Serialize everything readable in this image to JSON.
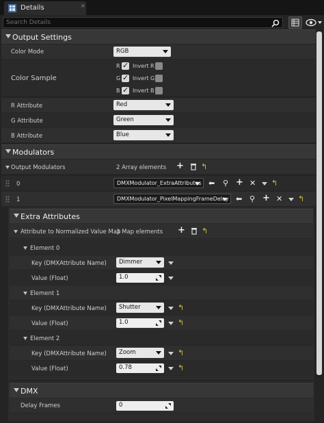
{
  "tab": {
    "title": "Details",
    "close": "×"
  },
  "search": {
    "placeholder": "Search Details"
  },
  "output_settings": {
    "title": "Output Settings",
    "color_mode": {
      "label": "Color Mode",
      "value": "RGB"
    },
    "color_sample": {
      "label": "Color Sample",
      "channels": [
        {
          "name": "R",
          "checked": true,
          "invert_label": "Invert R",
          "invert": false
        },
        {
          "name": "G",
          "checked": true,
          "invert_label": "Invert G",
          "invert": false
        },
        {
          "name": "B",
          "checked": true,
          "invert_label": "Invert B",
          "invert": false
        }
      ]
    },
    "r_attribute": {
      "label": "R Attribute",
      "value": "Red"
    },
    "g_attribute": {
      "label": "G Attribute",
      "value": "Green"
    },
    "b_attribute": {
      "label": "B Attribute",
      "value": "Blue"
    }
  },
  "modulators": {
    "title": "Modulators",
    "output_modulators": {
      "label": "Output Modulators",
      "count_text": "2 Array elements"
    },
    "elements": [
      {
        "index": "0",
        "value": "DMXModulator_ExtraAttributes"
      },
      {
        "index": "1",
        "value": "DMXModulator_PixelMappingFrameDelay"
      }
    ]
  },
  "extra_attributes": {
    "title": "Extra Attributes",
    "map_label": "Attribute to Normalized Value Map",
    "map_count": "3 Map elements",
    "key_label": "Key (DMXAttribute Name)",
    "value_label": "Value (Float)",
    "elements": [
      {
        "title": "Element 0",
        "key": "Dimmer",
        "value": "1.0"
      },
      {
        "title": "Element 1",
        "key": "Shutter",
        "value": "1.0"
      },
      {
        "title": "Element 2",
        "key": "Zoom",
        "value": "0.78"
      }
    ]
  },
  "dmx": {
    "title": "DMX",
    "delay_frames": {
      "label": "Delay Frames",
      "value": "0"
    }
  },
  "glyphs": {
    "add": "+",
    "reset": "↰",
    "remove": "✕",
    "insert": "⬅",
    "browse": "⚲",
    "check": "✓"
  },
  "colors": {
    "background": "#242424",
    "category": "#373737",
    "reset_arrow": "#d4c34a"
  }
}
